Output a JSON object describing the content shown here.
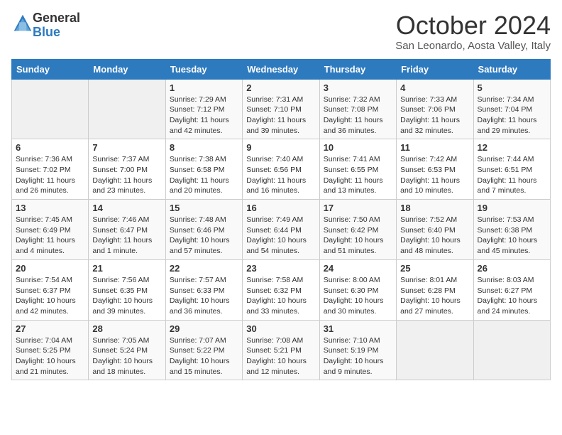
{
  "header": {
    "logo_general": "General",
    "logo_blue": "Blue",
    "month": "October 2024",
    "location": "San Leonardo, Aosta Valley, Italy"
  },
  "days_of_week": [
    "Sunday",
    "Monday",
    "Tuesday",
    "Wednesday",
    "Thursday",
    "Friday",
    "Saturday"
  ],
  "weeks": [
    [
      {
        "day": "",
        "info": ""
      },
      {
        "day": "",
        "info": ""
      },
      {
        "day": "1",
        "info": "Sunrise: 7:29 AM\nSunset: 7:12 PM\nDaylight: 11 hours and 42 minutes."
      },
      {
        "day": "2",
        "info": "Sunrise: 7:31 AM\nSunset: 7:10 PM\nDaylight: 11 hours and 39 minutes."
      },
      {
        "day": "3",
        "info": "Sunrise: 7:32 AM\nSunset: 7:08 PM\nDaylight: 11 hours and 36 minutes."
      },
      {
        "day": "4",
        "info": "Sunrise: 7:33 AM\nSunset: 7:06 PM\nDaylight: 11 hours and 32 minutes."
      },
      {
        "day": "5",
        "info": "Sunrise: 7:34 AM\nSunset: 7:04 PM\nDaylight: 11 hours and 29 minutes."
      }
    ],
    [
      {
        "day": "6",
        "info": "Sunrise: 7:36 AM\nSunset: 7:02 PM\nDaylight: 11 hours and 26 minutes."
      },
      {
        "day": "7",
        "info": "Sunrise: 7:37 AM\nSunset: 7:00 PM\nDaylight: 11 hours and 23 minutes."
      },
      {
        "day": "8",
        "info": "Sunrise: 7:38 AM\nSunset: 6:58 PM\nDaylight: 11 hours and 20 minutes."
      },
      {
        "day": "9",
        "info": "Sunrise: 7:40 AM\nSunset: 6:56 PM\nDaylight: 11 hours and 16 minutes."
      },
      {
        "day": "10",
        "info": "Sunrise: 7:41 AM\nSunset: 6:55 PM\nDaylight: 11 hours and 13 minutes."
      },
      {
        "day": "11",
        "info": "Sunrise: 7:42 AM\nSunset: 6:53 PM\nDaylight: 11 hours and 10 minutes."
      },
      {
        "day": "12",
        "info": "Sunrise: 7:44 AM\nSunset: 6:51 PM\nDaylight: 11 hours and 7 minutes."
      }
    ],
    [
      {
        "day": "13",
        "info": "Sunrise: 7:45 AM\nSunset: 6:49 PM\nDaylight: 11 hours and 4 minutes."
      },
      {
        "day": "14",
        "info": "Sunrise: 7:46 AM\nSunset: 6:47 PM\nDaylight: 11 hours and 1 minute."
      },
      {
        "day": "15",
        "info": "Sunrise: 7:48 AM\nSunset: 6:46 PM\nDaylight: 10 hours and 57 minutes."
      },
      {
        "day": "16",
        "info": "Sunrise: 7:49 AM\nSunset: 6:44 PM\nDaylight: 10 hours and 54 minutes."
      },
      {
        "day": "17",
        "info": "Sunrise: 7:50 AM\nSunset: 6:42 PM\nDaylight: 10 hours and 51 minutes."
      },
      {
        "day": "18",
        "info": "Sunrise: 7:52 AM\nSunset: 6:40 PM\nDaylight: 10 hours and 48 minutes."
      },
      {
        "day": "19",
        "info": "Sunrise: 7:53 AM\nSunset: 6:38 PM\nDaylight: 10 hours and 45 minutes."
      }
    ],
    [
      {
        "day": "20",
        "info": "Sunrise: 7:54 AM\nSunset: 6:37 PM\nDaylight: 10 hours and 42 minutes."
      },
      {
        "day": "21",
        "info": "Sunrise: 7:56 AM\nSunset: 6:35 PM\nDaylight: 10 hours and 39 minutes."
      },
      {
        "day": "22",
        "info": "Sunrise: 7:57 AM\nSunset: 6:33 PM\nDaylight: 10 hours and 36 minutes."
      },
      {
        "day": "23",
        "info": "Sunrise: 7:58 AM\nSunset: 6:32 PM\nDaylight: 10 hours and 33 minutes."
      },
      {
        "day": "24",
        "info": "Sunrise: 8:00 AM\nSunset: 6:30 PM\nDaylight: 10 hours and 30 minutes."
      },
      {
        "day": "25",
        "info": "Sunrise: 8:01 AM\nSunset: 6:28 PM\nDaylight: 10 hours and 27 minutes."
      },
      {
        "day": "26",
        "info": "Sunrise: 8:03 AM\nSunset: 6:27 PM\nDaylight: 10 hours and 24 minutes."
      }
    ],
    [
      {
        "day": "27",
        "info": "Sunrise: 7:04 AM\nSunset: 5:25 PM\nDaylight: 10 hours and 21 minutes."
      },
      {
        "day": "28",
        "info": "Sunrise: 7:05 AM\nSunset: 5:24 PM\nDaylight: 10 hours and 18 minutes."
      },
      {
        "day": "29",
        "info": "Sunrise: 7:07 AM\nSunset: 5:22 PM\nDaylight: 10 hours and 15 minutes."
      },
      {
        "day": "30",
        "info": "Sunrise: 7:08 AM\nSunset: 5:21 PM\nDaylight: 10 hours and 12 minutes."
      },
      {
        "day": "31",
        "info": "Sunrise: 7:10 AM\nSunset: 5:19 PM\nDaylight: 10 hours and 9 minutes."
      },
      {
        "day": "",
        "info": ""
      },
      {
        "day": "",
        "info": ""
      }
    ]
  ]
}
